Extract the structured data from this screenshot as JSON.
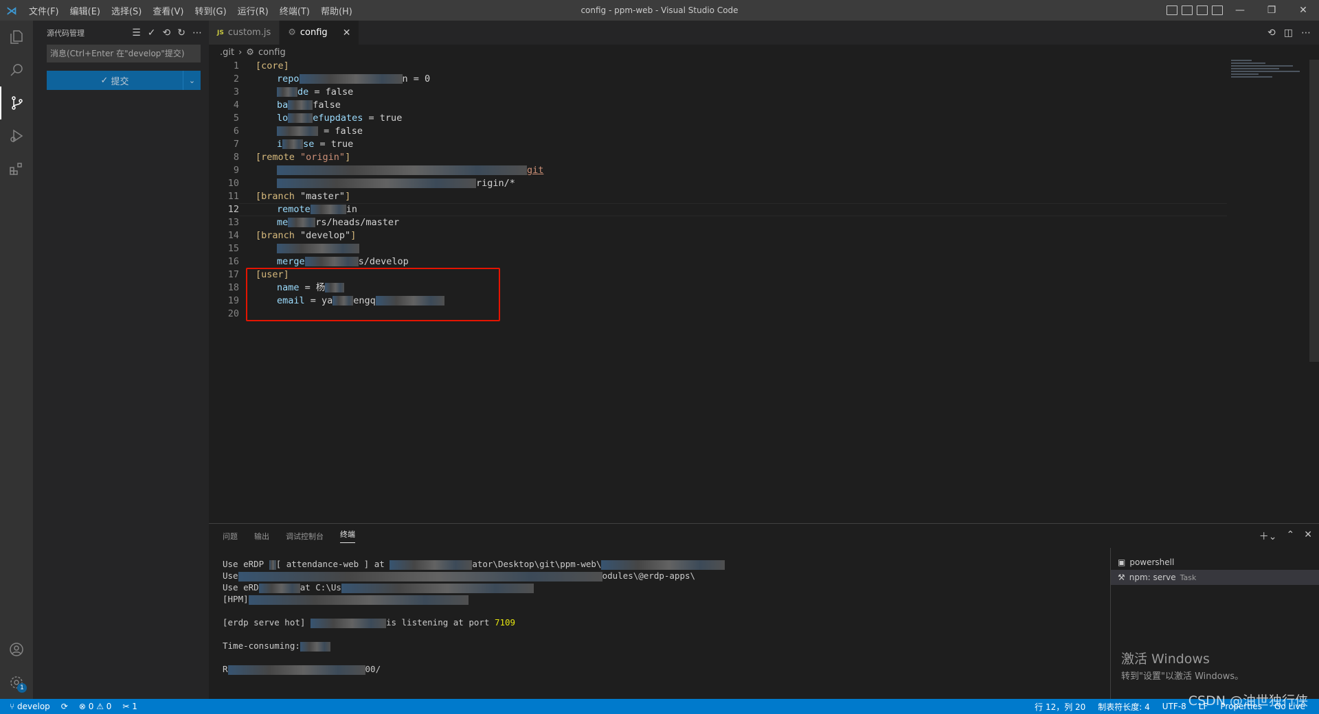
{
  "window": {
    "title": "config - ppm-web - Visual Studio Code",
    "menu": [
      "文件(F)",
      "编辑(E)",
      "选择(S)",
      "查看(V)",
      "转到(G)",
      "运行(R)",
      "终端(T)",
      "帮助(H)"
    ]
  },
  "sidebar": {
    "title": "源代码管理",
    "message_placeholder": "消息(Ctrl+Enter 在\"develop\"提交)",
    "commit_label": "提交"
  },
  "tabs": [
    {
      "label": "custom.js",
      "icon": "JS"
    },
    {
      "label": "config",
      "icon": "gear-icon"
    }
  ],
  "breadcrumb": {
    "folder": ".git",
    "file": "config"
  },
  "editor": {
    "lines": [
      {
        "n": "1",
        "sec": "[core]"
      },
      {
        "n": "2",
        "key": "repo",
        "rest": "n = 0"
      },
      {
        "n": "3",
        "key": "de",
        "rest": " = false"
      },
      {
        "n": "4",
        "key": "ba",
        "rest": "false"
      },
      {
        "n": "5",
        "key": "lo",
        "rest2": "efupdates",
        "rest": " = true"
      },
      {
        "n": "6",
        "rest": " = false"
      },
      {
        "n": "7",
        "key": "i",
        "rest2": "se",
        "rest": " = true"
      },
      {
        "n": "8",
        "sec": "[remote ",
        "secstr": "\"origin\"",
        "sec2": "]"
      },
      {
        "n": "9",
        "rest": "git"
      },
      {
        "n": "10",
        "rest": "rigin/*"
      },
      {
        "n": "11",
        "sec": "[branch ",
        "plain": "\"master\"",
        "sec2": "]"
      },
      {
        "n": "12",
        "key": "remote",
        "rest": "in"
      },
      {
        "n": "13",
        "key": "me",
        "rest": "rs/heads/master"
      },
      {
        "n": "14",
        "sec": "[branch ",
        "plain": "\"develop\"",
        "sec2": "]"
      },
      {
        "n": "15",
        "rest": ""
      },
      {
        "n": "16",
        "key": "merge",
        "rest": "s/develop"
      },
      {
        "n": "17",
        "sec": "[user]"
      },
      {
        "n": "18",
        "key": "name",
        "rest": " = 杨"
      },
      {
        "n": "19",
        "key": "email",
        "rest": " = ya",
        "rest2": "engq"
      },
      {
        "n": "20"
      }
    ]
  },
  "panel": {
    "tabs": [
      "问题",
      "输出",
      "调试控制台",
      "终端"
    ],
    "terminal_lines": [
      {
        "a": "Use eRDP ",
        "b": "[ attendance-web ] at ",
        "c": "ator\\Desktop\\git\\ppm-web\\"
      },
      {
        "a": "Use",
        "b": "",
        "c": "odules\\@erdp-apps\\"
      },
      {
        "a": "Use eRD",
        "b": "at C:\\Us",
        "c": ""
      },
      {
        "a": "[HPM]",
        "b": "",
        "c": ""
      },
      {
        "a": "",
        "b": "",
        "c": ""
      },
      {
        "a": "[erdp serve hot] ",
        "b": "is listening at port ",
        "c": "7109"
      },
      {
        "a": "",
        "b": "",
        "c": ""
      },
      {
        "a": "Time-consuming:",
        "b": "",
        "c": ""
      },
      {
        "a": "",
        "b": "",
        "c": ""
      },
      {
        "a": "R",
        "b": "",
        "c": "00/"
      }
    ],
    "terminals": [
      {
        "label": "powershell",
        "task": ""
      },
      {
        "label": "npm: serve",
        "task": "Task"
      }
    ]
  },
  "activation": {
    "line1": "激活 Windows",
    "line2": "转到\"设置\"以激活 Windows。"
  },
  "statusbar": {
    "branch": "develop",
    "errors": "0",
    "warnings": "0",
    "ports": "1",
    "position": "行 12，列 20",
    "tabsize": "制表符长度: 4",
    "encoding": "UTF-8",
    "eol": "LF",
    "language": "Properties",
    "golive": "Go Live"
  },
  "watermark": "CSDN @油世独行侠"
}
